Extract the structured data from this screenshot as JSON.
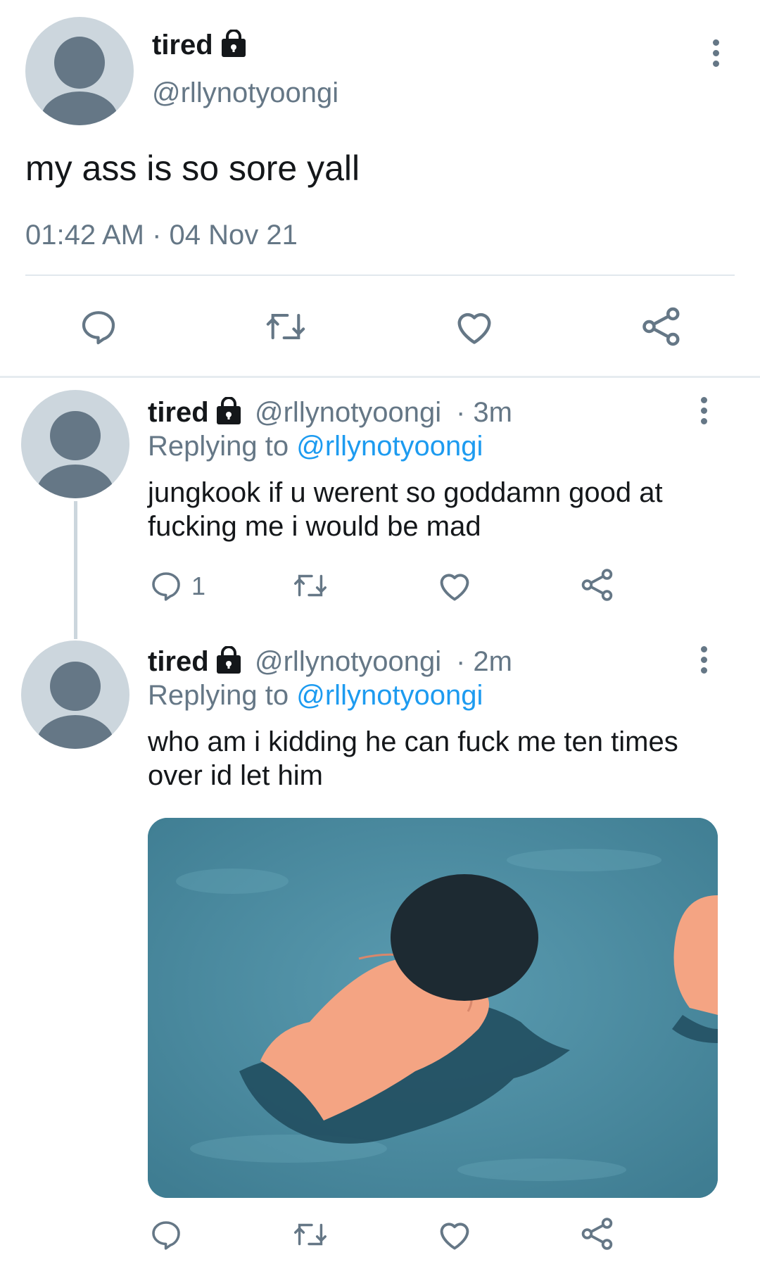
{
  "main_tweet": {
    "display_name": "tired",
    "handle": "@rllynotyoongi",
    "text": "my ass is so sore yall",
    "timestamp": "01:42 AM · 04 Nov 21"
  },
  "reply_1": {
    "display_name": "tired",
    "handle": "@rllynotyoongi",
    "time": "· 3m",
    "replying_label": "Replying to",
    "replying_to": "@rllynotyoongi",
    "text_line1": "jungkook if u werent so goddamn good at",
    "text_line2": "fucking me i would be mad",
    "reply_count": "1"
  },
  "reply_2": {
    "display_name": "tired",
    "handle": "@rllynotyoongi",
    "time": "· 2m",
    "replying_label": "Replying to",
    "replying_to": "@rllynotyoongi",
    "text_line1": "who am i kidding he can fuck me ten times",
    "text_line2": "over id let him"
  },
  "colors": {
    "icon_gray": "#657786",
    "link_blue": "#1d9bf0",
    "avatar_bg": "#ccd6dd"
  },
  "icons": [
    "lock-icon",
    "more-vertical-icon",
    "reply-icon",
    "retweet-icon",
    "like-icon",
    "share-icon"
  ]
}
